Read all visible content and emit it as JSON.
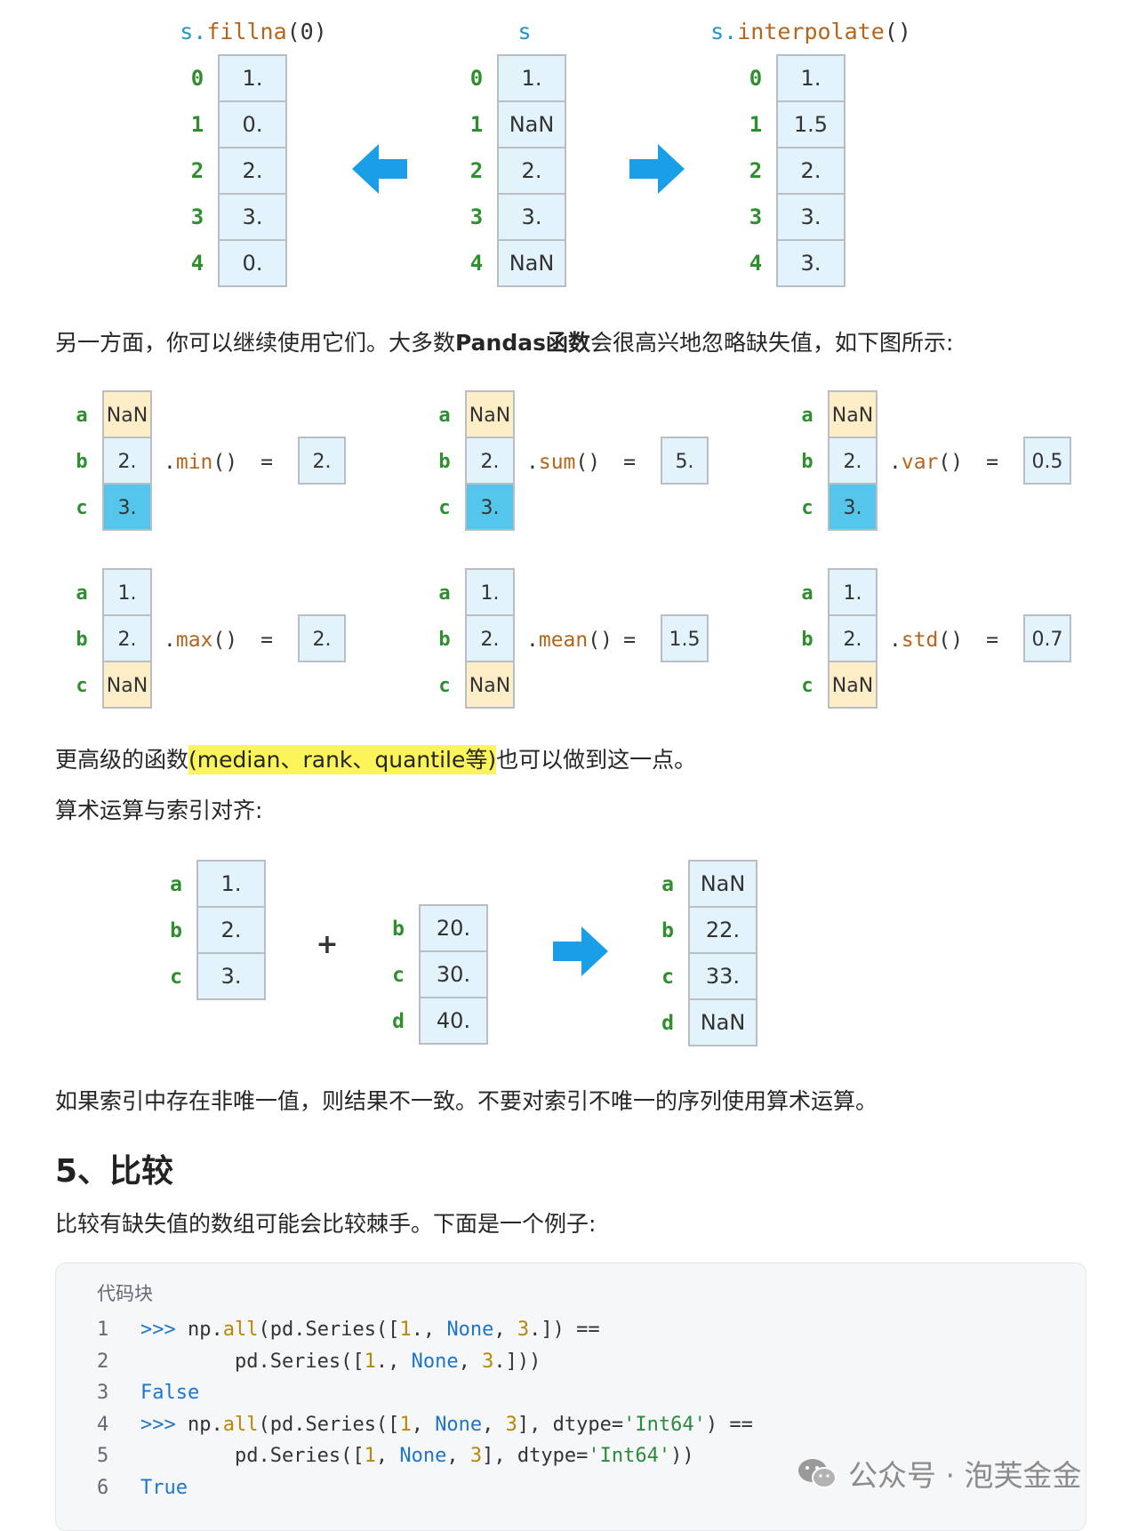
{
  "fill_diagram": {
    "titles": [
      "s.fillna(0)",
      "s",
      "s.interpolate()"
    ],
    "index": [
      "0",
      "1",
      "2",
      "3",
      "4"
    ],
    "columns": [
      [
        "1.",
        "0.",
        "2.",
        "3.",
        "0."
      ],
      [
        "1.",
        "NaN",
        "2.",
        "3.",
        "NaN"
      ],
      [
        "1.",
        "1.5",
        "2.",
        "3.",
        "3."
      ]
    ]
  },
  "text": {
    "p1_a": "另一方面，你可以继续使用它们。大多数",
    "p1_b": "Pandas函数",
    "p1_c": "会很高兴地忽略缺失值，如下图所示:",
    "p2_a": "更高级的函数",
    "p2_b": "(median、rank、quantile等)",
    "p2_c": "也可以做到这一点。",
    "p3": "算术运算与索引对齐:",
    "p4": "如果索引中存在非唯一值，则结果不一致。不要对索引不唯一的序列使用算术运算。",
    "h2": "5、比较",
    "p5": "比较有缺失值的数组可能会比较棘手。下面是一个例子:"
  },
  "agg_diagram": {
    "labels": [
      "a",
      "b",
      "c"
    ],
    "operations": [
      {
        "name": ".min()",
        "values": [
          "NaN",
          "2.",
          "3."
        ],
        "result": "2."
      },
      {
        "name": ".sum()",
        "values": [
          "NaN",
          "2.",
          "3."
        ],
        "result": "5."
      },
      {
        "name": ".var()",
        "values": [
          "NaN",
          "2.",
          "3."
        ],
        "result": "0.5"
      },
      {
        "name": ".max()",
        "values": [
          "1.",
          "2.",
          "NaN"
        ],
        "result": "2."
      },
      {
        "name": ".mean()",
        "values": [
          "1.",
          "2.",
          "NaN"
        ],
        "result": "1.5"
      },
      {
        "name": ".std()",
        "values": [
          "1.",
          "2.",
          "NaN"
        ],
        "result": "0.7"
      }
    ],
    "eq": "="
  },
  "align_diagram": {
    "left": {
      "index": [
        "a",
        "b",
        "c"
      ],
      "values": [
        "1.",
        "2.",
        "3."
      ]
    },
    "plus": "+",
    "right": {
      "index": [
        "b",
        "c",
        "d"
      ],
      "values": [
        "20.",
        "30.",
        "40."
      ]
    },
    "result": {
      "index": [
        "a",
        "b",
        "c",
        "d"
      ],
      "values": [
        "NaN",
        "22.",
        "33.",
        "NaN"
      ]
    }
  },
  "code": {
    "title": "代码块",
    "lines": [
      {
        "n": "1",
        "text": ">>> np.all(pd.Series([1., None, 3.]) =="
      },
      {
        "n": "2",
        "text": "        pd.Series([1., None, 3.]))"
      },
      {
        "n": "3",
        "text": "False"
      },
      {
        "n": "4",
        "text": ">>> np.all(pd.Series([1, None, 3], dtype='Int64') =="
      },
      {
        "n": "5",
        "text": "        pd.Series([1, None, 3], dtype='Int64'))"
      },
      {
        "n": "6",
        "text": "True"
      }
    ]
  },
  "watermark": "公众号 · 泡芙金金",
  "colors": {
    "cell_light": "#e3f3fb",
    "cell_blue": "#54c6ec",
    "cell_nan": "#fdeec8",
    "cell_border": "#b9bec4",
    "arrow": "#1a9ee8",
    "index_green": "#2f8f2f",
    "func_brown": "#b5651d",
    "title_blue": "#2196c9"
  }
}
